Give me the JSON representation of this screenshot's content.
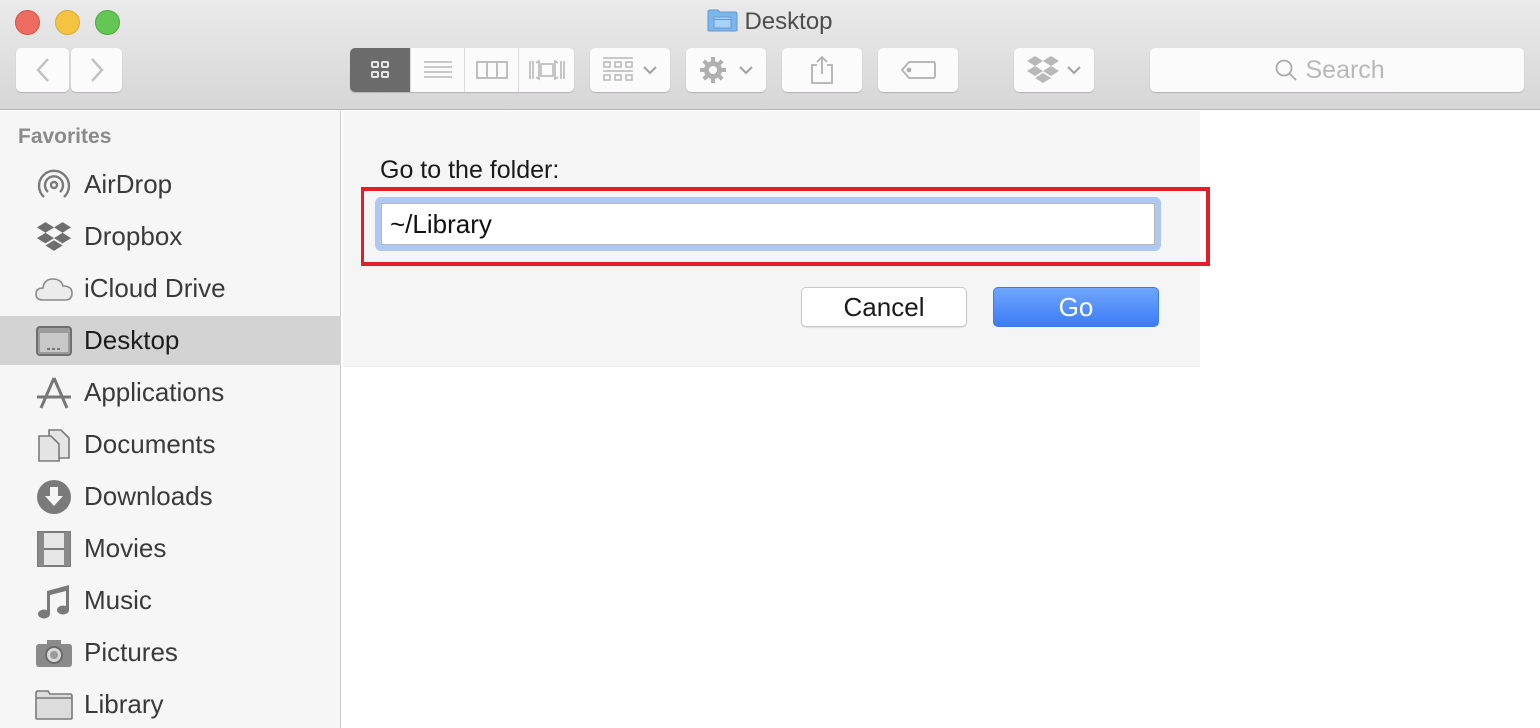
{
  "window": {
    "title": "Desktop",
    "colors": {
      "close": "#ed6b5f",
      "minimize": "#f5c342",
      "maximize": "#63c655"
    }
  },
  "toolbar": {
    "back_icon": "chevron-left-icon",
    "forward_icon": "chevron-right-icon",
    "view_modes": [
      {
        "name": "icon-view",
        "selected": true
      },
      {
        "name": "list-view",
        "selected": false
      },
      {
        "name": "column-view",
        "selected": false
      },
      {
        "name": "cover-flow-view",
        "selected": false
      }
    ],
    "arrange_icon": "grid-arrange-icon",
    "action_icon": "gear-icon",
    "share_icon": "share-icon",
    "tag_icon": "tag-icon",
    "dropbox_icon": "dropbox-icon",
    "search_placeholder": "Search"
  },
  "sidebar": {
    "heading": "Favorites",
    "items": [
      {
        "label": "AirDrop",
        "icon": "airdrop-icon",
        "selected": false
      },
      {
        "label": "Dropbox",
        "icon": "dropbox-icon",
        "selected": false
      },
      {
        "label": "iCloud Drive",
        "icon": "cloud-icon",
        "selected": false
      },
      {
        "label": "Desktop",
        "icon": "desktop-icon",
        "selected": true
      },
      {
        "label": "Applications",
        "icon": "applications-icon",
        "selected": false
      },
      {
        "label": "Documents",
        "icon": "documents-icon",
        "selected": false
      },
      {
        "label": "Downloads",
        "icon": "downloads-icon",
        "selected": false
      },
      {
        "label": "Movies",
        "icon": "film-icon",
        "selected": false
      },
      {
        "label": "Music",
        "icon": "music-note-icon",
        "selected": false
      },
      {
        "label": "Pictures",
        "icon": "camera-icon",
        "selected": false
      },
      {
        "label": "Library",
        "icon": "folder-icon",
        "selected": false
      }
    ]
  },
  "dialog": {
    "label": "Go to the folder:",
    "path_value": "~/Library",
    "cancel_label": "Cancel",
    "go_label": "Go",
    "highlight_color": "#e31e2a",
    "accent_color": "#3d7cf6"
  }
}
